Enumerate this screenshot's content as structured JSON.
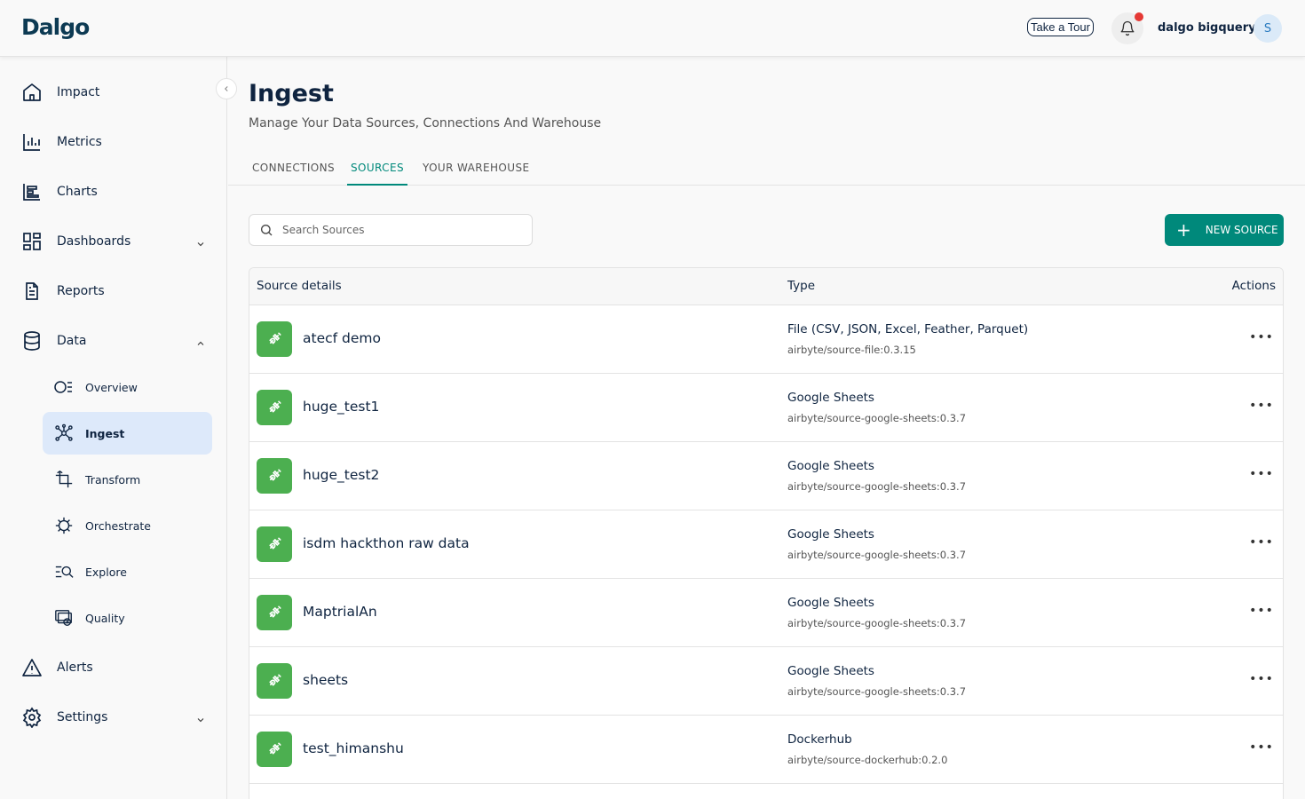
{
  "header": {
    "logo": "Dalgo",
    "tour_label": "Take a Tour",
    "org_name": "dalgo bigquery",
    "avatar_initial": "S"
  },
  "sidebar": {
    "items": [
      {
        "label": "Impact",
        "icon": "home-icon"
      },
      {
        "label": "Metrics",
        "icon": "bar-chart-icon"
      },
      {
        "label": "Charts",
        "icon": "chart-icon"
      },
      {
        "label": "Dashboards",
        "icon": "dashboard-icon"
      },
      {
        "label": "Reports",
        "icon": "report-icon"
      },
      {
        "label": "Data",
        "icon": "database-icon"
      },
      {
        "label": "Alerts",
        "icon": "alert-icon"
      },
      {
        "label": "Settings",
        "icon": "gear-icon"
      }
    ],
    "data_subitems": [
      {
        "label": "Overview",
        "icon": "overview-icon"
      },
      {
        "label": "Ingest",
        "icon": "ingest-icon",
        "active": true
      },
      {
        "label": "Transform",
        "icon": "transform-icon"
      },
      {
        "label": "Orchestrate",
        "icon": "orchestrate-icon"
      },
      {
        "label": "Explore",
        "icon": "explore-icon"
      },
      {
        "label": "Quality",
        "icon": "quality-icon"
      }
    ]
  },
  "page": {
    "title": "Ingest",
    "subtitle": "Manage Your Data Sources, Connections And Warehouse",
    "tabs": [
      {
        "label": "CONNECTIONS"
      },
      {
        "label": "SOURCES",
        "active": true
      },
      {
        "label": "YOUR WAREHOUSE"
      }
    ]
  },
  "search": {
    "placeholder": "Search Sources"
  },
  "new_source_label": "NEW SOURCE",
  "table": {
    "columns": [
      "Source details",
      "Type",
      "Actions"
    ],
    "rows": [
      {
        "name": "atecf demo",
        "type": "File (CSV, JSON, Excel, Feather, Parquet)",
        "image": "airbyte/source-file:0.3.15"
      },
      {
        "name": "huge_test1",
        "type": "Google Sheets",
        "image": "airbyte/source-google-sheets:0.3.7"
      },
      {
        "name": "huge_test2",
        "type": "Google Sheets",
        "image": "airbyte/source-google-sheets:0.3.7"
      },
      {
        "name": "isdm hackthon raw data",
        "type": "Google Sheets",
        "image": "airbyte/source-google-sheets:0.3.7"
      },
      {
        "name": "MaptrialAn",
        "type": "Google Sheets",
        "image": "airbyte/source-google-sheets:0.3.7"
      },
      {
        "name": "sheets",
        "type": "Google Sheets",
        "image": "airbyte/source-google-sheets:0.3.7"
      },
      {
        "name": "test_himanshu",
        "type": "Dockerhub",
        "image": "airbyte/source-dockerhub:0.2.0"
      }
    ]
  },
  "colors": {
    "accent": "#00897b",
    "source_badge": "#4caf50",
    "active_nav": "#dde9fa",
    "notification": "#e53935"
  }
}
